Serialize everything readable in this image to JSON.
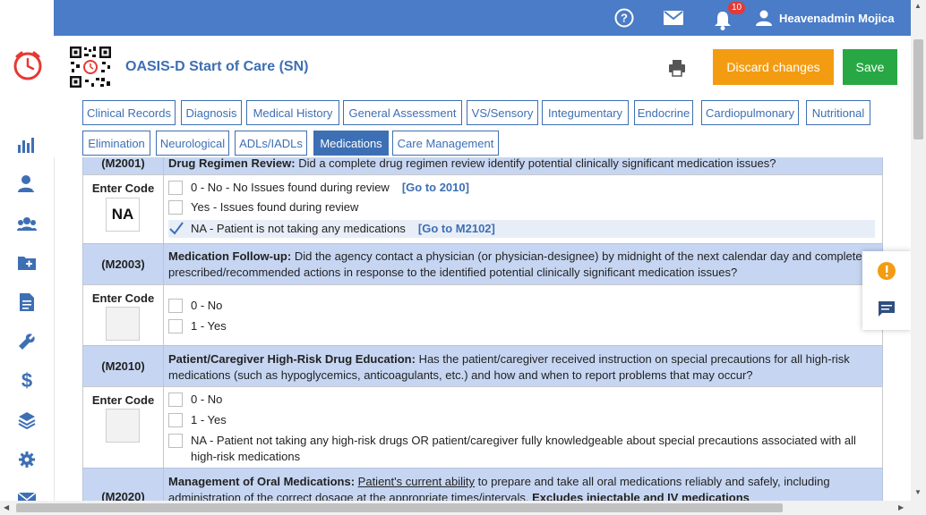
{
  "topbar": {
    "notification_count": "10",
    "user_name": "Heavenadmin Mojica"
  },
  "header": {
    "title": "OASIS-D Start of Care (SN)",
    "discard_label": "Discard changes",
    "save_label": "Save"
  },
  "tabs": [
    {
      "label": "Clinical Records"
    },
    {
      "label": "Diagnosis"
    },
    {
      "label": "Medical History"
    },
    {
      "label": "General Assessment"
    },
    {
      "label": "VS/Sensory"
    },
    {
      "label": "Integumentary"
    },
    {
      "label": "Endocrine"
    },
    {
      "label": "Cardiopulmonary"
    },
    {
      "label": "Nutritional"
    },
    {
      "label": "Elimination"
    },
    {
      "label": "Neurological"
    },
    {
      "label": "ADLs/IADLs"
    },
    {
      "label": "Medications"
    },
    {
      "label": "Care Management"
    }
  ],
  "active_tab": "Medications",
  "sections": {
    "m2001": {
      "code": "(M2001)",
      "title": "Drug Regimen Review:",
      "question": "Did a complete drug regimen review identify potential clinically significant medication issues?",
      "enter_code_label": "Enter Code",
      "code_value": "NA",
      "options": [
        {
          "text": "0 - No - No Issues found during review",
          "link": "[Go to 2010]"
        },
        {
          "text": "Yes - Issues found during review",
          "link": ""
        },
        {
          "text": "NA - Patient is not taking any medications",
          "link": "[Go to M2102]"
        }
      ]
    },
    "m2003": {
      "code": "(M2003)",
      "title": "Medication Follow-up:",
      "question": "Did the agency contact a physician (or physician-designee) by midnight of the next calendar day and completed prescribed/recommended actions in response to the identified potential clinically significant medication issues?",
      "enter_code_label": "Enter Code",
      "code_value": "",
      "options": [
        {
          "text": "0 - No"
        },
        {
          "text": "1 - Yes"
        }
      ]
    },
    "m2010": {
      "code": "(M2010)",
      "title": "Patient/Caregiver High-Risk Drug Education:",
      "question": "Has the patient/caregiver received instruction on special precautions for all high-risk medications (such as hypoglycemics, anticoagulants, etc.) and how and when to report problems that may occur?",
      "enter_code_label": "Enter Code",
      "code_value": "",
      "options": [
        {
          "text": "0 - No"
        },
        {
          "text": "1 - Yes"
        },
        {
          "text": "NA - Patient not taking any high-risk drugs OR patient/caregiver fully knowledgeable about special precautions associated with all high-risk medications"
        }
      ]
    },
    "m2020": {
      "code": "(M2020)",
      "title": "Management of Oral Medications:",
      "underlined": "Patient's current ability",
      "question": "to prepare and take all oral medications reliably and safely, including administration of the correct dosage at the appropriate times/intervals.",
      "emphasis": "Excludes injectable and IV medications"
    }
  }
}
